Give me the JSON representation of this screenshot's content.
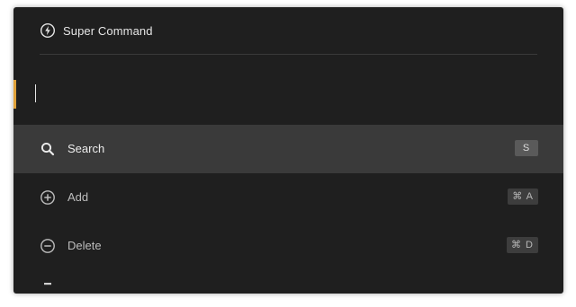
{
  "header": {
    "title": "Super Command",
    "icon": "bolt-circle-icon"
  },
  "input": {
    "value": "",
    "placeholder": ""
  },
  "colors": {
    "accent": "#e0a23a",
    "background": "#1f1f1f",
    "selected_row": "#3a3a3a"
  },
  "commands": [
    {
      "label": "Search",
      "shortcut": "S",
      "icon": "search-icon",
      "selected": true
    },
    {
      "label": "Add",
      "shortcut": "⌘ A",
      "icon": "plus-circle-icon",
      "selected": false
    },
    {
      "label": "Delete",
      "shortcut": "⌘ D",
      "icon": "minus-circle-icon",
      "selected": false
    }
  ]
}
